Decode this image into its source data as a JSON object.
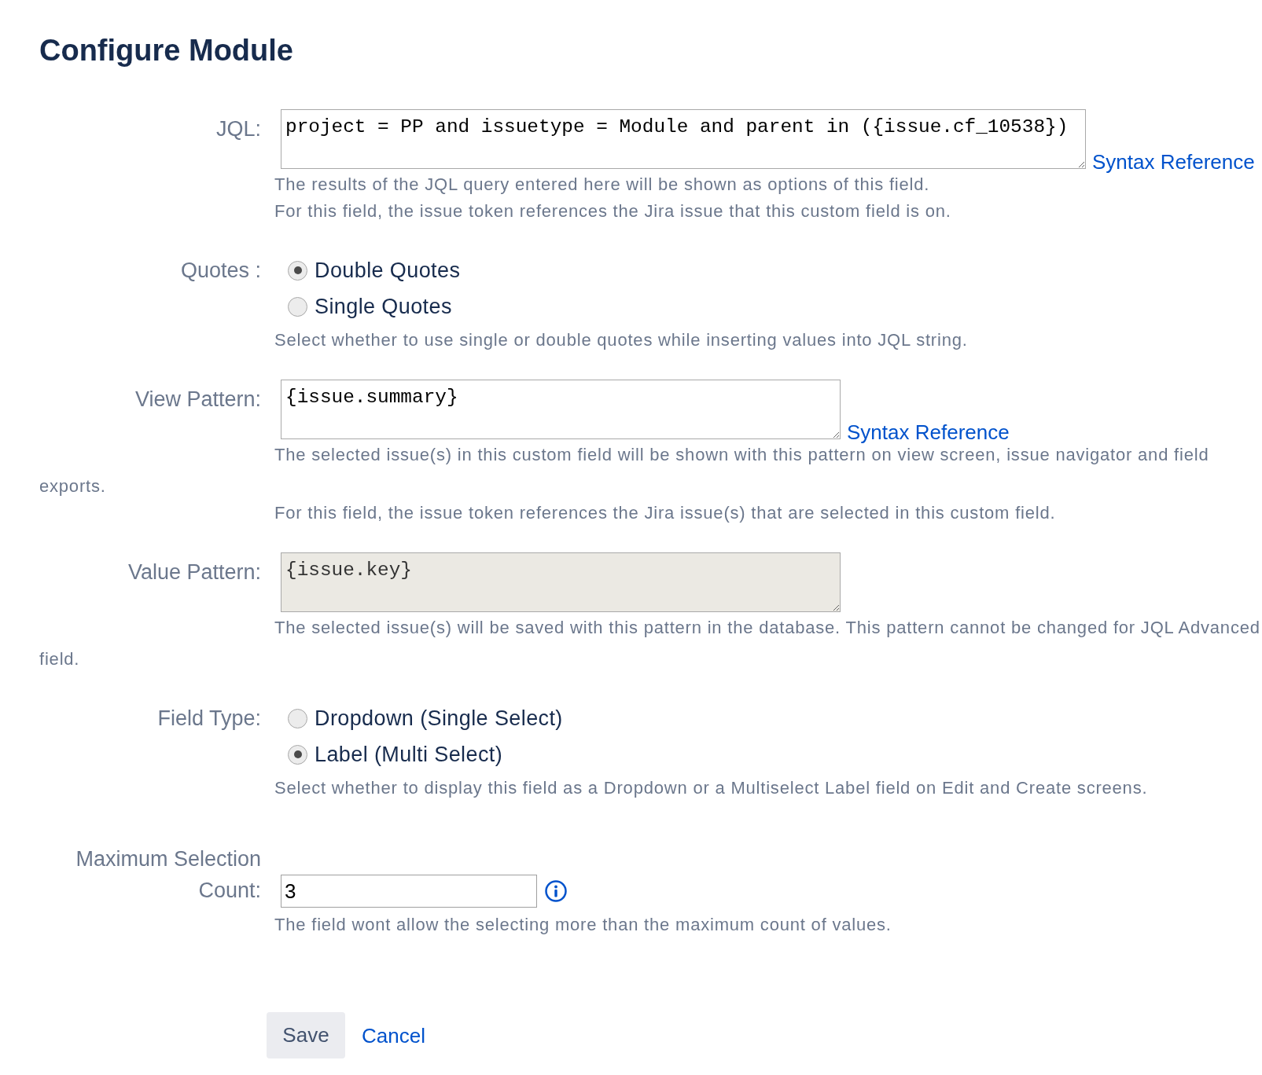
{
  "page": {
    "title": "Configure Module"
  },
  "fields": [
    {
      "kind": "textarea",
      "label": "JQL:",
      "value": "project = PP and issuetype = Module and parent in ({issue.cf_10538})",
      "disabled": false,
      "link": "Syntax Reference",
      "help": [
        "The results of the JQL query entered here will be shown as options of this field.",
        "For this field, the issue token references the Jira issue that this custom field is on."
      ]
    },
    {
      "kind": "radio",
      "label": "Quotes :",
      "options": [
        {
          "label": "Double Quotes",
          "selected": true
        },
        {
          "label": "Single Quotes",
          "selected": false
        }
      ],
      "help": [
        "Select whether to use single or double quotes while inserting values into JQL string."
      ]
    },
    {
      "kind": "textarea",
      "label": "View Pattern:",
      "value": "{issue.summary}",
      "disabled": false,
      "link": "Syntax Reference",
      "help": [
        "The selected issue(s) in this custom field will be shown with this pattern on view screen, issue navigator and field exports.",
        "For this field, the issue token references the Jira issue(s) that are selected in this custom field."
      ]
    },
    {
      "kind": "textarea",
      "label": "Value Pattern:",
      "value": "{issue.key}",
      "disabled": true,
      "help": [
        "The selected issue(s) will be saved with this pattern in the database. This pattern cannot be changed for JQL Advanced field."
      ]
    },
    {
      "kind": "radio",
      "label": "Field Type:",
      "options": [
        {
          "label": "Dropdown (Single Select)",
          "selected": false
        },
        {
          "label": "Label (Multi Select)",
          "selected": true
        }
      ],
      "help": [
        "Select whether to display this field as a Dropdown or a Multiselect Label field on Edit and Create screens."
      ]
    },
    {
      "kind": "number",
      "label": "Maximum Selection Count:",
      "value": "3",
      "info": true,
      "help": [
        "The field wont allow the selecting more than the maximum count of values."
      ]
    }
  ],
  "actions": {
    "save": "Save",
    "cancel": "Cancel"
  }
}
